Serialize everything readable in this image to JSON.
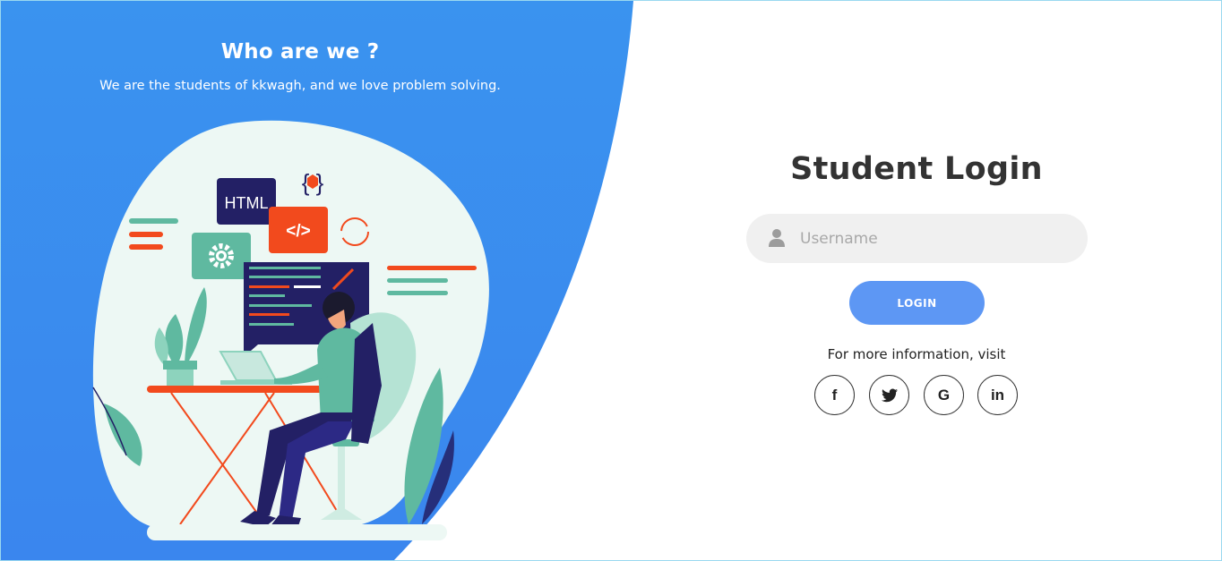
{
  "colors": {
    "left_panel_blue": "#3a8ff0",
    "login_button": "#5d97f4",
    "input_background": "#f0f0f0",
    "title_text": "#333333"
  },
  "about": {
    "title": "Who are we ?",
    "subtitle": "We are the students of kkwagh, and we love problem solving."
  },
  "illustration": {
    "html_card_label": "HTML",
    "code_card_label": "</>",
    "braces_label": "{ }"
  },
  "login": {
    "title": "Student Login",
    "username_placeholder": "Username",
    "username_value": "",
    "button_label": "LOGIN"
  },
  "info": {
    "text": "For more information, visit"
  },
  "social": [
    {
      "name": "facebook",
      "icon": "facebook-icon",
      "glyph": "f"
    },
    {
      "name": "twitter",
      "icon": "twitter-icon",
      "glyph": ""
    },
    {
      "name": "google",
      "icon": "google-icon",
      "glyph": "G"
    },
    {
      "name": "linkedin",
      "icon": "linkedin-icon",
      "glyph": "in"
    }
  ]
}
